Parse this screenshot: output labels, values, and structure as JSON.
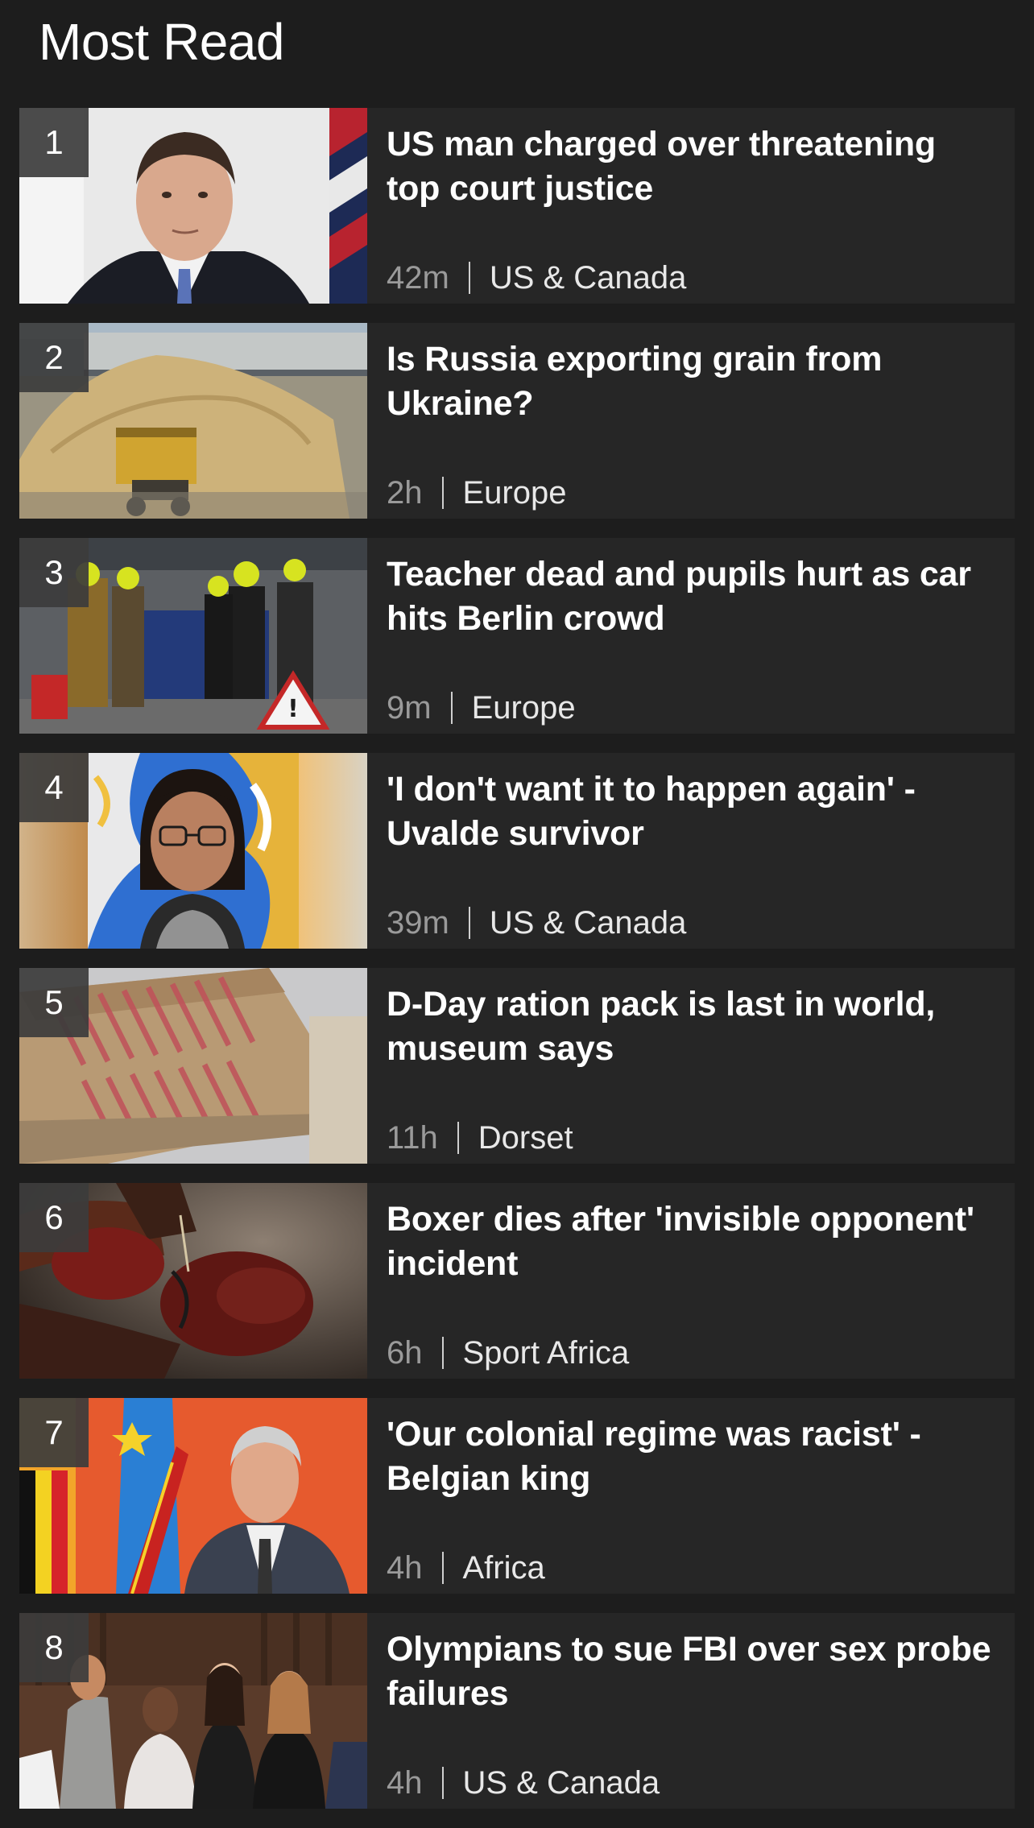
{
  "title": "Most Read",
  "items": [
    {
      "rank": "1",
      "headline": "US man charged over threatening top court justice",
      "time": "42m",
      "section": "US & Canada"
    },
    {
      "rank": "2",
      "headline": "Is Russia exporting grain from Ukraine?",
      "time": "2h",
      "section": "Europe"
    },
    {
      "rank": "3",
      "headline": "Teacher dead and pupils hurt as car hits Berlin crowd",
      "time": "9m",
      "section": "Europe"
    },
    {
      "rank": "4",
      "headline": "'I don't want it to happen again' - Uvalde survivor",
      "time": "39m",
      "section": "US & Canada"
    },
    {
      "rank": "5",
      "headline": "D-Day ration pack is last in world, museum says",
      "time": "11h",
      "section": "Dorset"
    },
    {
      "rank": "6",
      "headline": "Boxer dies after 'invisible opponent' incident",
      "time": "6h",
      "section": "Sport Africa"
    },
    {
      "rank": "7",
      "headline": "'Our colonial regime was racist' - Belgian king",
      "time": "4h",
      "section": "Africa"
    },
    {
      "rank": "8",
      "headline": "Olympians to sue FBI over sex probe failures",
      "time": "4h",
      "section": "US & Canada"
    }
  ]
}
